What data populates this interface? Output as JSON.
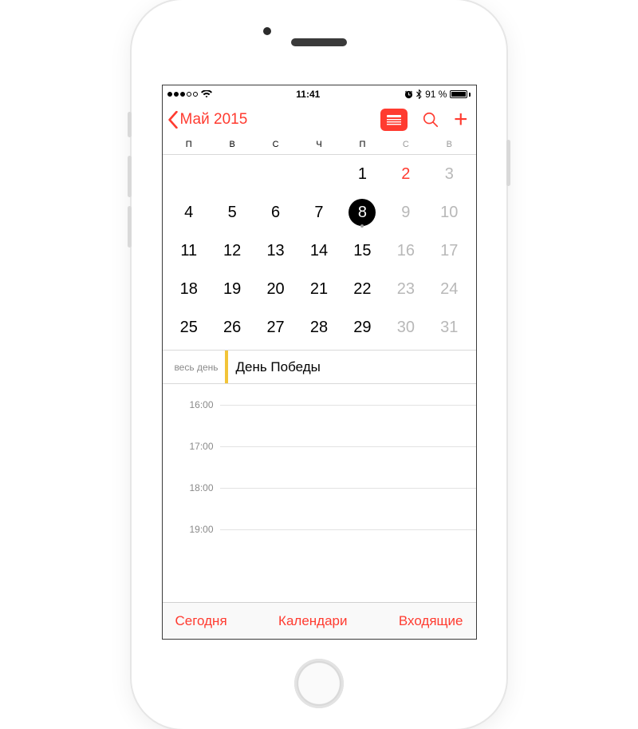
{
  "status": {
    "time": "11:41",
    "signal_filled": 3,
    "battery_pct": "91 %"
  },
  "nav": {
    "back_label": "Май 2015"
  },
  "weekdays": [
    "П",
    "В",
    "С",
    "Ч",
    "П",
    "С",
    "В"
  ],
  "month": {
    "rows": [
      [
        "",
        "",
        "",
        "",
        "1",
        "2",
        "3"
      ],
      [
        "4",
        "5",
        "6",
        "7",
        "8",
        "9",
        "10"
      ],
      [
        "11",
        "12",
        "13",
        "14",
        "15",
        "16",
        "17"
      ],
      [
        "18",
        "19",
        "20",
        "21",
        "22",
        "23",
        "24"
      ],
      [
        "25",
        "26",
        "27",
        "28",
        "29",
        "30",
        "31"
      ]
    ],
    "selected": "8",
    "red_days": [
      "2"
    ]
  },
  "allday": {
    "label": "весь день",
    "event": "День Победы"
  },
  "timeline": {
    "hours": [
      "16:00",
      "17:00",
      "18:00",
      "19:00"
    ]
  },
  "toolbar": {
    "today": "Сегодня",
    "calendars": "Календари",
    "inbox": "Входящие"
  }
}
